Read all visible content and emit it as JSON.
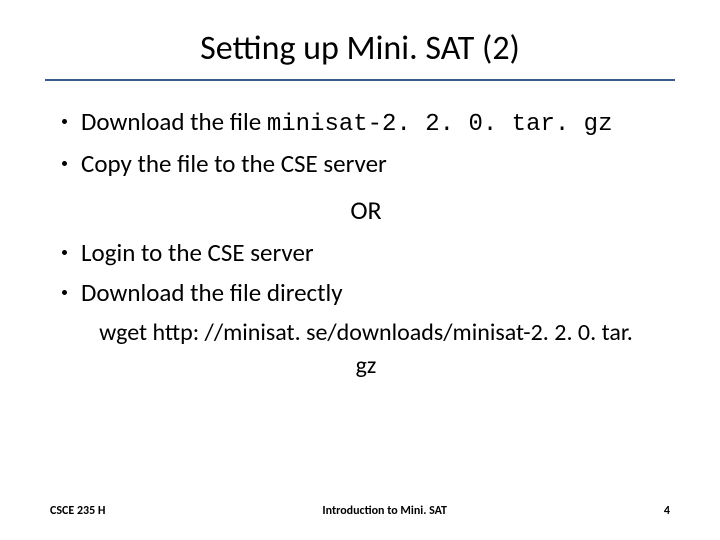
{
  "title": "Setting up Mini. SAT (2)",
  "bullets1": [
    {
      "prefix": "Download the file ",
      "code": "minisat-2. 2. 0. tar. gz"
    },
    {
      "prefix": "Copy the file to the CSE server",
      "code": ""
    }
  ],
  "or_label": "OR",
  "bullets2": [
    {
      "text": "Login to the CSE server"
    },
    {
      "text": "Download the file directly"
    }
  ],
  "command": "wget http: //minisat. se/downloads/minisat-2. 2. 0. tar. gz",
  "footer": {
    "left": "CSCE 235 H",
    "center": "Introduction to Mini. SAT",
    "page": "4"
  }
}
